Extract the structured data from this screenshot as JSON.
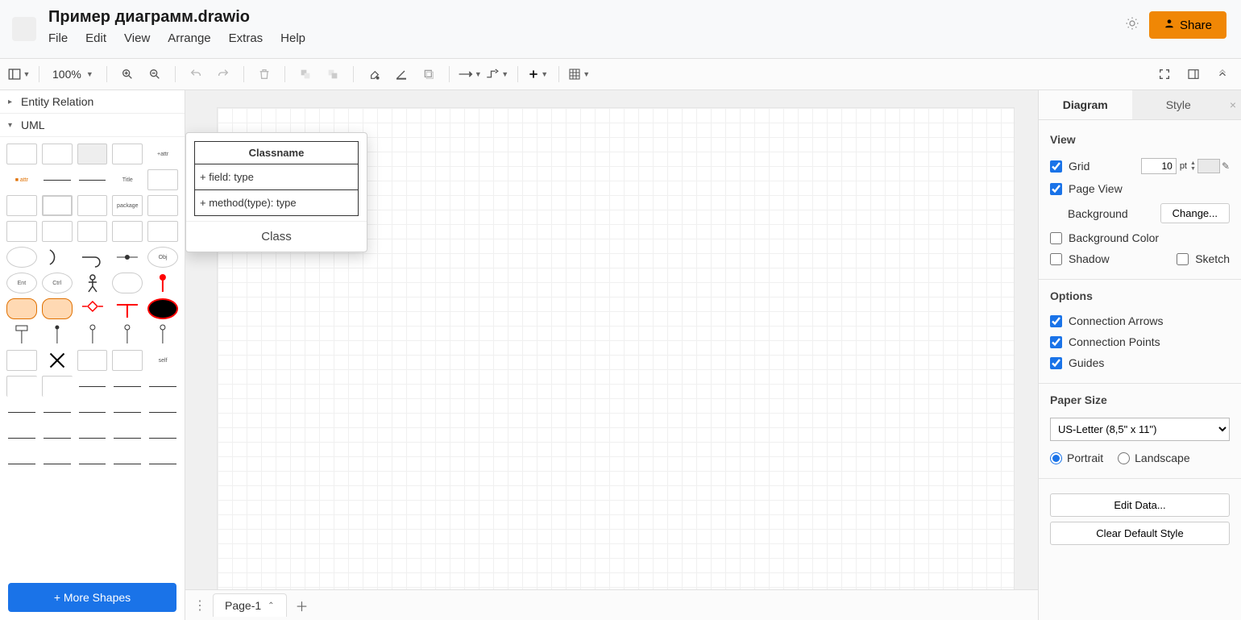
{
  "header": {
    "title": "Пример диаграмм.drawio",
    "menu": [
      "File",
      "Edit",
      "View",
      "Arrange",
      "Extras",
      "Help"
    ],
    "share_label": "Share"
  },
  "toolbar": {
    "zoom": "100%"
  },
  "shapes": {
    "sections": [
      {
        "name": "Entity Relation",
        "expanded": false
      },
      {
        "name": "UML",
        "expanded": true
      }
    ],
    "more_shapes_label": "+ More Shapes"
  },
  "preview": {
    "class_name": "Classname",
    "field_row": "+ field: type",
    "method_row": "+ method(type): type",
    "label": "Class"
  },
  "pages": {
    "active": "Page-1"
  },
  "format": {
    "tabs": {
      "diagram": "Diagram",
      "style": "Style"
    },
    "view": {
      "heading": "View",
      "grid_label": "Grid",
      "grid_checked": true,
      "grid_size": "10",
      "grid_unit": "pt",
      "page_view_label": "Page View",
      "page_view_checked": true,
      "background_label": "Background",
      "change_label": "Change...",
      "background_color_label": "Background Color",
      "background_color_checked": false,
      "shadow_label": "Shadow",
      "shadow_checked": false,
      "sketch_label": "Sketch",
      "sketch_checked": false
    },
    "options": {
      "heading": "Options",
      "connection_arrows_label": "Connection Arrows",
      "connection_arrows_checked": true,
      "connection_points_label": "Connection Points",
      "connection_points_checked": true,
      "guides_label": "Guides",
      "guides_checked": true
    },
    "paper": {
      "heading": "Paper Size",
      "selected": "US-Letter (8,5\" x 11\")",
      "portrait_label": "Portrait",
      "landscape_label": "Landscape",
      "orientation": "portrait"
    },
    "buttons": {
      "edit_data": "Edit Data...",
      "clear_default": "Clear Default Style"
    }
  }
}
